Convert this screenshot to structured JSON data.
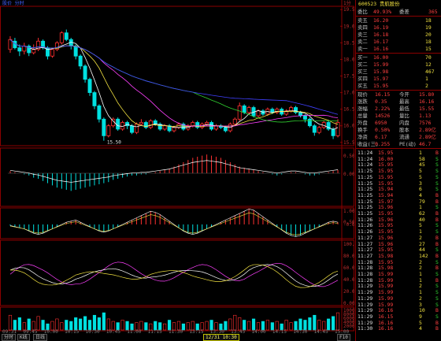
{
  "chart_header": {
    "title": "股价 分时",
    "corner_label": "1分"
  },
  "price_axis": [
    "19.50",
    "19.00",
    "18.50",
    "18.00",
    "17.50",
    "17.00",
    "16.50",
    "16.00",
    "15.50"
  ],
  "low_mark": "15.50",
  "indicator_axes": {
    "macd": [
      "0.50",
      "0.00"
    ],
    "kdj": [
      "1.00",
      "0.50",
      "-0.64"
    ],
    "rsi": [
      "100.00",
      "80.00",
      "60.00",
      "40.00",
      "20.00",
      "0.00"
    ],
    "vol": [
      "10000",
      "8000",
      "6000",
      "4000",
      "2000"
    ]
  },
  "time_axis": [
    "09:31",
    "09:45",
    "10:00",
    "10:15",
    "10:30",
    "10:45",
    "11:00",
    "11:15",
    "11:30",
    "13:15",
    "13:30",
    "13:45",
    "14:00",
    "14:15",
    "14:30",
    "14:45",
    "15:00"
  ],
  "cursor_time": "12/31 10:30",
  "bottom_tabs": [
    "分时",
    "K线",
    "日线"
  ],
  "bottom_corner": "F10",
  "quote": {
    "code": "600523",
    "name": "贵航股份",
    "wb_label": "委比",
    "wb_value": "49.93%",
    "wc_label": "委差",
    "wc_value": "365",
    "sell": [
      {
        "label": "卖五",
        "price": "16.20",
        "vol": "18"
      },
      {
        "label": "卖四",
        "price": "16.19",
        "vol": "19"
      },
      {
        "label": "卖三",
        "price": "16.18",
        "vol": "20"
      },
      {
        "label": "卖二",
        "price": "16.17",
        "vol": "18"
      },
      {
        "label": "卖一",
        "price": "16.16",
        "vol": "15"
      }
    ],
    "buy": [
      {
        "label": "买一",
        "price": "16.00",
        "vol": "70"
      },
      {
        "label": "买二",
        "price": "15.99",
        "vol": "12"
      },
      {
        "label": "买三",
        "price": "15.98",
        "vol": "467"
      },
      {
        "label": "买四",
        "price": "15.97",
        "vol": "1"
      },
      {
        "label": "买五",
        "price": "15.95",
        "vol": "2"
      }
    ],
    "stats": [
      {
        "l1": "现价",
        "v1": "16.15",
        "l2": "今开",
        "v2": "15.80"
      },
      {
        "l1": "涨跌",
        "v1": "0.35",
        "l2": "最高",
        "v2": "16.16"
      },
      {
        "l1": "涨幅",
        "v1": "2.22%",
        "l2": "最低",
        "v2": "15.55"
      },
      {
        "l1": "总量",
        "v1": "14526",
        "l2": "量比",
        "v2": "1.13"
      },
      {
        "l1": "外盘",
        "v1": "6950",
        "l2": "内盘",
        "v2": "7576"
      },
      {
        "l1": "换手",
        "v1": "0.50%",
        "l2": "股本",
        "v2": "2.89亿"
      },
      {
        "l1": "净资",
        "v1": "6.17",
        "l2": "流通",
        "v2": "2.89亿"
      },
      {
        "l1": "收益(三)",
        "v1": "0.255",
        "l2": "PE(动)",
        "v2": "46.7"
      }
    ],
    "ticks": [
      {
        "t": "11:24",
        "p": "15.95",
        "v": "1",
        "d": "B"
      },
      {
        "t": "11:24",
        "p": "16.00",
        "v": "58",
        "d": "S"
      },
      {
        "t": "11:24",
        "p": "15.95",
        "v": "45",
        "d": "S"
      },
      {
        "t": "11:25",
        "p": "15.95",
        "v": "5",
        "d": "S"
      },
      {
        "t": "11:25",
        "p": "15.95",
        "v": "5",
        "d": "S"
      },
      {
        "t": "11:25",
        "p": "15.95",
        "v": "3",
        "d": "S"
      },
      {
        "t": "11:25",
        "p": "15.94",
        "v": "6",
        "d": "S"
      },
      {
        "t": "11:25",
        "p": "15.94",
        "v": "4",
        "d": "B"
      },
      {
        "t": "11:25",
        "p": "15.97",
        "v": "79",
        "d": "B"
      },
      {
        "t": "11:25",
        "p": "15.96",
        "v": "1",
        "d": "S"
      },
      {
        "t": "11:25",
        "p": "15.95",
        "v": "62",
        "d": "B"
      },
      {
        "t": "11:26",
        "p": "15.96",
        "v": "40",
        "d": "B"
      },
      {
        "t": "11:26",
        "p": "15.95",
        "v": "5",
        "d": "S"
      },
      {
        "t": "11:26",
        "p": "15.95",
        "v": "1",
        "d": "S"
      },
      {
        "t": "11:27",
        "p": "15.96",
        "v": "2",
        "d": "B"
      },
      {
        "t": "11:27",
        "p": "15.96",
        "v": "27",
        "d": "B"
      },
      {
        "t": "11:27",
        "p": "15.95",
        "v": "44",
        "d": "S"
      },
      {
        "t": "11:27",
        "p": "15.98",
        "v": "142",
        "d": "B"
      },
      {
        "t": "11:28",
        "p": "15.95",
        "v": "2",
        "d": "S"
      },
      {
        "t": "11:28",
        "p": "15.98",
        "v": "2",
        "d": "B"
      },
      {
        "t": "11:28",
        "p": "15.99",
        "v": "1",
        "d": "S"
      },
      {
        "t": "11:28",
        "p": "15.99",
        "v": "1",
        "d": "B"
      },
      {
        "t": "11:29",
        "p": "15.99",
        "v": "2",
        "d": "S"
      },
      {
        "t": "11:29",
        "p": "15.99",
        "v": "1",
        "d": "S"
      },
      {
        "t": "11:29",
        "p": "15.99",
        "v": "2",
        "d": "S"
      },
      {
        "t": "11:29",
        "p": "15.99",
        "v": "3",
        "d": "S"
      },
      {
        "t": "11:29",
        "p": "16.16",
        "v": "10",
        "d": "B"
      },
      {
        "t": "11:29",
        "p": "16.15",
        "v": "9",
        "d": "S"
      },
      {
        "t": "11:29",
        "p": "16.16",
        "v": "5",
        "d": "B"
      },
      {
        "t": "11:30",
        "p": "16.16",
        "v": "4",
        "d": "B"
      }
    ]
  },
  "colors": {
    "up": "#ff3030",
    "down": "#00e0e0",
    "grid": "#8b0000",
    "ma5": "#ffffff",
    "ma10": "#f0e040",
    "ma20": "#ff40ff",
    "ma60": "#30d030",
    "ma120": "#4040ff"
  },
  "candles": [
    [
      18.3,
      18.6,
      18.7,
      18.2
    ],
    [
      18.55,
      18.35,
      18.65,
      18.3
    ],
    [
      18.35,
      18.25,
      18.45,
      18.1
    ],
    [
      18.25,
      18.4,
      18.5,
      18.15
    ],
    [
      18.4,
      18.2,
      18.45,
      18.1
    ],
    [
      18.2,
      18.3,
      18.45,
      18.15
    ],
    [
      18.3,
      18.55,
      18.65,
      18.25
    ],
    [
      18.55,
      18.35,
      18.6,
      18.3
    ],
    [
      18.35,
      18.1,
      18.4,
      18.0
    ],
    [
      18.1,
      18.3,
      18.35,
      18.05
    ],
    [
      18.3,
      18.5,
      18.55,
      18.25
    ],
    [
      18.5,
      18.8,
      18.85,
      18.45
    ],
    [
      18.8,
      18.6,
      18.9,
      18.55
    ],
    [
      18.6,
      18.4,
      18.65,
      18.3
    ],
    [
      18.4,
      18.1,
      18.45,
      18.0
    ],
    [
      18.1,
      17.8,
      18.15,
      17.7
    ],
    [
      17.8,
      17.4,
      17.85,
      17.3
    ],
    [
      17.4,
      17.0,
      17.45,
      16.9
    ],
    [
      17.0,
      16.6,
      17.05,
      16.5
    ],
    [
      16.6,
      16.2,
      16.65,
      16.1
    ],
    [
      16.2,
      15.7,
      16.25,
      15.55
    ],
    [
      15.7,
      16.0,
      16.05,
      15.65
    ],
    [
      16.0,
      16.2,
      16.25,
      15.95
    ],
    [
      16.2,
      15.9,
      16.25,
      15.85
    ],
    [
      15.9,
      16.1,
      16.15,
      15.85
    ],
    [
      16.1,
      16.0,
      16.15,
      15.9
    ],
    [
      16.0,
      15.8,
      16.05,
      15.75
    ],
    [
      15.8,
      16.05,
      16.1,
      15.75
    ],
    [
      16.05,
      16.1,
      16.2,
      16.0
    ],
    [
      16.1,
      15.95,
      16.15,
      15.9
    ],
    [
      15.95,
      16.15,
      16.2,
      15.9
    ],
    [
      16.15,
      16.05,
      16.2,
      16.0
    ],
    [
      16.05,
      15.9,
      16.1,
      15.85
    ],
    [
      15.9,
      16.0,
      16.05,
      15.85
    ],
    [
      16.0,
      15.85,
      16.05,
      15.8
    ],
    [
      15.85,
      15.95,
      16.0,
      15.8
    ],
    [
      15.95,
      16.05,
      16.1,
      15.9
    ],
    [
      16.05,
      15.9,
      16.1,
      15.85
    ],
    [
      15.9,
      16.0,
      16.05,
      15.85
    ],
    [
      16.0,
      16.1,
      16.15,
      15.95
    ],
    [
      16.1,
      15.95,
      16.15,
      15.9
    ],
    [
      15.95,
      16.05,
      16.1,
      15.9
    ],
    [
      16.05,
      16.1,
      16.15,
      16.0
    ],
    [
      16.1,
      15.9,
      16.15,
      15.85
    ],
    [
      15.9,
      16.0,
      16.05,
      15.85
    ],
    [
      16.0,
      15.95,
      16.05,
      15.9
    ],
    [
      15.95,
      15.85,
      16.0,
      15.8
    ],
    [
      15.85,
      16.05,
      16.1,
      15.8
    ],
    [
      16.05,
      16.2,
      16.25,
      16.0
    ],
    [
      16.2,
      16.6,
      16.7,
      16.15
    ],
    [
      16.6,
      16.4,
      16.65,
      16.35
    ],
    [
      16.4,
      16.55,
      16.6,
      16.35
    ],
    [
      16.55,
      16.3,
      16.6,
      16.25
    ],
    [
      16.3,
      16.45,
      16.5,
      16.25
    ],
    [
      16.45,
      16.35,
      16.5,
      16.3
    ],
    [
      16.35,
      16.5,
      16.55,
      16.3
    ],
    [
      16.5,
      16.4,
      16.55,
      16.35
    ],
    [
      16.4,
      16.5,
      16.55,
      16.35
    ],
    [
      16.5,
      16.35,
      16.55,
      16.3
    ],
    [
      16.35,
      16.45,
      16.5,
      16.3
    ],
    [
      16.45,
      16.55,
      16.6,
      16.4
    ],
    [
      16.55,
      16.4,
      16.6,
      16.35
    ],
    [
      16.4,
      16.3,
      16.45,
      16.25
    ],
    [
      16.3,
      16.2,
      16.35,
      16.1
    ],
    [
      16.2,
      16.0,
      16.25,
      15.95
    ],
    [
      16.0,
      15.8,
      16.05,
      15.7
    ],
    [
      15.8,
      15.95,
      16.0,
      15.75
    ],
    [
      15.95,
      16.1,
      16.15,
      15.9
    ],
    [
      16.1,
      15.9,
      16.15,
      15.85
    ],
    [
      15.9,
      15.7,
      15.95,
      15.6
    ],
    [
      15.7,
      16.1,
      16.2,
      15.65
    ]
  ],
  "vol_values": [
    12,
    8,
    10,
    6,
    9,
    7,
    11,
    8,
    5,
    7,
    9,
    6,
    8,
    7,
    10,
    9,
    11,
    8,
    12,
    10,
    14,
    9,
    7,
    6,
    8,
    7,
    5,
    6,
    7,
    6,
    5,
    7,
    6,
    5,
    8,
    6,
    7,
    5,
    6,
    7,
    5,
    6,
    7,
    8,
    6,
    5,
    7,
    9,
    12,
    10,
    8,
    7,
    9,
    6,
    7,
    8,
    6,
    7,
    5,
    8,
    6,
    7,
    9,
    8,
    10,
    12,
    8,
    7,
    9,
    11,
    14
  ],
  "macd_values": [
    0.02,
    0.01,
    0.0,
    -0.01,
    -0.02,
    -0.04,
    -0.05,
    -0.07,
    -0.09,
    -0.11,
    -0.13,
    -0.14,
    -0.15,
    -0.16,
    -0.15,
    -0.14,
    -0.13,
    -0.12,
    -0.11,
    -0.1,
    -0.09,
    -0.08,
    -0.06,
    -0.05,
    -0.04,
    -0.03,
    -0.02,
    -0.02,
    -0.01,
    -0.01,
    0.0,
    0.01,
    0.02,
    0.03,
    0.04,
    0.06,
    0.08,
    0.1,
    0.12,
    0.14,
    0.15,
    0.16,
    0.17,
    0.16,
    0.15,
    0.14,
    0.12,
    0.1,
    0.08,
    0.06,
    0.05,
    0.04,
    0.03,
    0.02,
    0.01,
    0.0,
    -0.01,
    -0.02,
    -0.01,
    0.0,
    0.01,
    0.01,
    0.0,
    -0.01,
    -0.02,
    -0.02,
    -0.01,
    0.0,
    0.01,
    0.02,
    0.03
  ],
  "kdj_values": [
    -0.05,
    -0.1,
    -0.15,
    -0.2,
    -0.3,
    -0.4,
    -0.45,
    -0.4,
    -0.3,
    -0.2,
    -0.1,
    0.0,
    0.1,
    0.15,
    0.2,
    0.1,
    0.0,
    -0.1,
    -0.2,
    -0.3,
    -0.35,
    -0.3,
    -0.2,
    -0.1,
    0.0,
    0.1,
    0.2,
    0.3,
    0.4,
    0.5,
    0.6,
    0.55,
    0.45,
    0.3,
    0.15,
    0.0,
    -0.15,
    -0.3,
    -0.4,
    -0.45,
    -0.4,
    -0.3,
    -0.2,
    -0.1,
    0.0,
    0.1,
    0.2,
    0.3,
    0.4,
    0.5,
    0.6,
    0.7,
    0.65,
    0.5,
    0.35,
    0.2,
    0.05,
    -0.1,
    -0.25,
    -0.4,
    -0.5,
    -0.55,
    -0.5,
    -0.4,
    -0.3,
    -0.2,
    -0.1,
    0.0,
    0.1,
    0.15,
    0.1
  ]
}
